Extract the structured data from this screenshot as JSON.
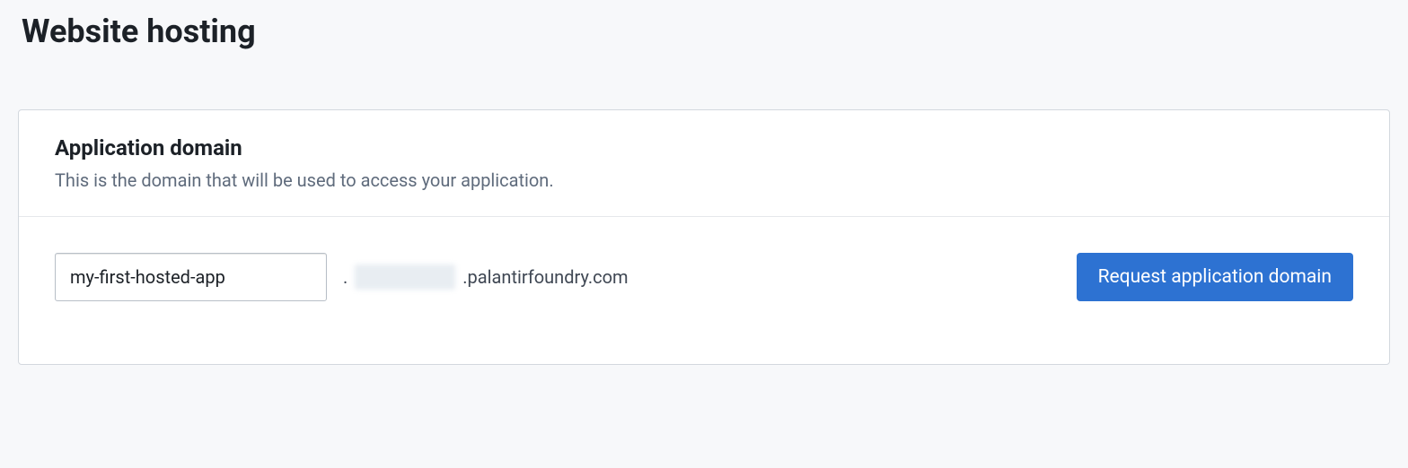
{
  "page": {
    "title": "Website hosting"
  },
  "card": {
    "header": {
      "title": "Application domain",
      "description": "This is the domain that will be used to access your application."
    },
    "body": {
      "domain_input_value": "my-first-hosted-app",
      "domain_dot": ".",
      "domain_suffix": ".palantirfoundry.com",
      "request_button_label": "Request application domain"
    }
  }
}
